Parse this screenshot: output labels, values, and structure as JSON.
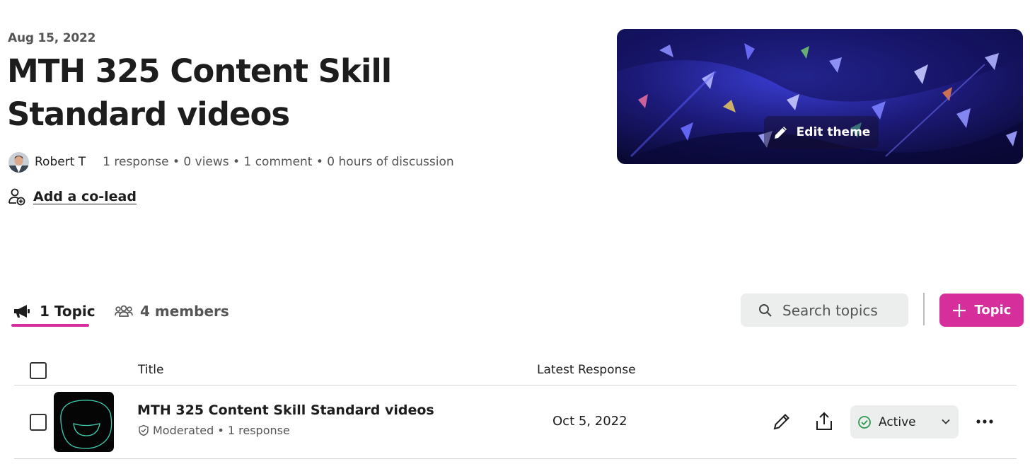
{
  "header": {
    "date": "Aug 15, 2022",
    "title": "MTH 325 Content Skill Standard videos"
  },
  "meta": {
    "author": "Robert T",
    "stats": "1 response • 0 views • 1 comment • 0 hours of discussion"
  },
  "co_lead": {
    "label": "Add a co-lead"
  },
  "theme": {
    "edit_label": "Edit theme"
  },
  "tabs": [
    {
      "label": "1 Topic",
      "icon": "megaphone-icon",
      "active": true
    },
    {
      "label": "4 members",
      "icon": "members-icon",
      "active": false
    }
  ],
  "search": {
    "placeholder": "Search topics"
  },
  "add_topic": {
    "label": "Topic"
  },
  "table": {
    "columns": [
      "Title",
      "Latest Response"
    ],
    "rows": [
      {
        "title": "MTH 325 Content Skill Standard videos",
        "moderation": "Moderated",
        "responses": "1 response",
        "latest_response": "Oct 5, 2022",
        "status": "Active"
      }
    ]
  },
  "colors": {
    "accent": "#d62e9a",
    "status_active": "#2e9a4e",
    "text": "#1d1d1d"
  }
}
